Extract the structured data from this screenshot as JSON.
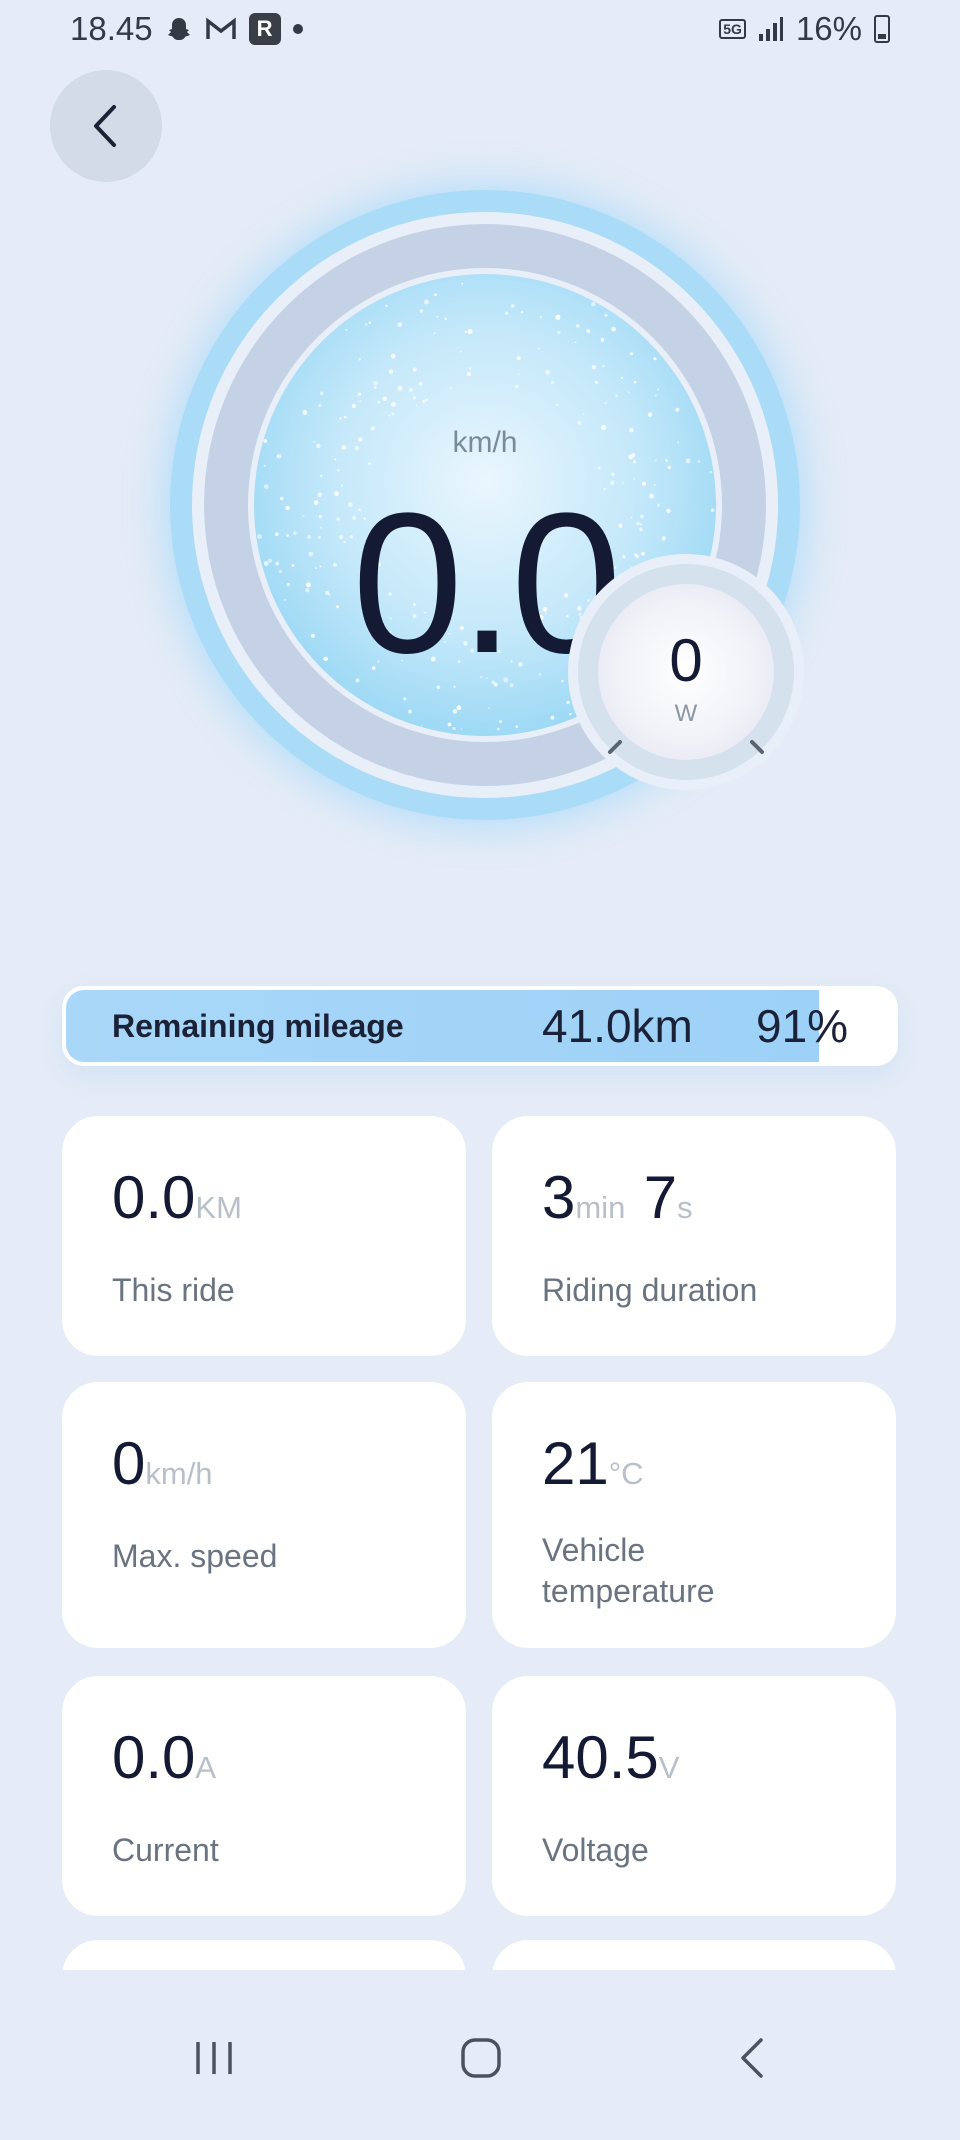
{
  "status_bar": {
    "time": "18.45",
    "network": "5G",
    "battery": "16%"
  },
  "gauge": {
    "speed": "0.0",
    "speed_unit": "km/h",
    "power": "0",
    "power_unit": "W"
  },
  "mileage": {
    "label": "Remaining mileage",
    "distance": "41.0km",
    "percent": "91%",
    "fill_fraction": 0.91
  },
  "stats": [
    {
      "value": "0.0",
      "unit": "KM",
      "label": "This ride"
    },
    {
      "value": "3",
      "unit": "min",
      "value2": "7",
      "unit2": "s",
      "label": "Riding duration"
    },
    {
      "value": "0",
      "unit": "km/h",
      "label": "Max. speed"
    },
    {
      "value": "21",
      "unit": "°C",
      "label_line1": "Vehicle",
      "label_line2": "temperature"
    },
    {
      "value": "0.0",
      "unit": "A",
      "label": "Current"
    },
    {
      "value": "40.5",
      "unit": "V",
      "label": "Voltage"
    }
  ],
  "icons": {
    "back": "chevron-left-icon",
    "nav_recents": "recents-icon",
    "nav_home": "home-icon",
    "nav_back": "back-icon"
  },
  "colors": {
    "background": "#e6ecf7",
    "ring": "#abdcf7",
    "mileage_fill": "#a8d7f8",
    "text_dark": "#141a33"
  }
}
